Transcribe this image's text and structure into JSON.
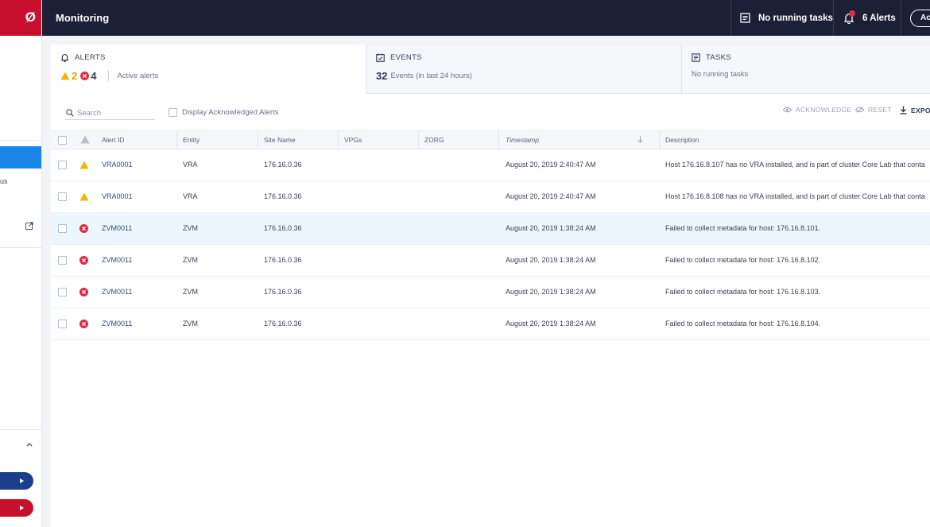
{
  "sidebar": {
    "logo_glyph": "Ø",
    "partial_item_label": "us"
  },
  "header": {
    "title": "Monitoring",
    "tasks_label": "No running tasks",
    "alerts_label": "6 Alerts",
    "action_label": "Ac"
  },
  "tabs": {
    "alerts": {
      "label": "ALERTS",
      "warning_count": "2",
      "error_count": "4",
      "subtitle": "Active alerts"
    },
    "events": {
      "label": "EVENTS",
      "count": "32",
      "subtitle": "Events (in last 24 hours)"
    },
    "tasks": {
      "label": "TASKS",
      "subtitle": "No running tasks"
    }
  },
  "toolbar": {
    "search_placeholder": "Search",
    "display_ack_label": "Display Acknowledged Alerts",
    "acknowledge_label": "ACKNOWLEDGE",
    "reset_label": "RESET",
    "export_label": "EXPO"
  },
  "table": {
    "columns": {
      "alert_id": "Alert ID",
      "entity": "Entity",
      "site_name": "Site Name",
      "vpgs": "VPGs",
      "zorg": "ZORG",
      "timestamp": "Timestamp",
      "description": "Description"
    },
    "rows": [
      {
        "severity": "warning",
        "alert_id": "VRA0001",
        "entity": "VRA",
        "site_name": "176.16.0.36",
        "vpgs": "",
        "zorg": "",
        "timestamp": "August 20, 2019 2:40:47 AM",
        "description": "Host 176.16.8.107 has no VRA installed, and is part of cluster Core Lab that conta"
      },
      {
        "severity": "warning",
        "alert_id": "VRA0001",
        "entity": "VRA",
        "site_name": "176.16.0.36",
        "vpgs": "",
        "zorg": "",
        "timestamp": "August 20, 2019 2:40:47 AM",
        "description": "Host 176.16.8.108 has no VRA installed, and is part of cluster Core Lab that conta"
      },
      {
        "severity": "error",
        "alert_id": "ZVM0011",
        "entity": "ZVM",
        "site_name": "176.16.0.36",
        "vpgs": "",
        "zorg": "",
        "timestamp": "August 20, 2019 1:38:24 AM",
        "description": "Failed to collect metadata for host: 176.16.8.101."
      },
      {
        "severity": "error",
        "alert_id": "ZVM0011",
        "entity": "ZVM",
        "site_name": "176.16.0.36",
        "vpgs": "",
        "zorg": "",
        "timestamp": "August 20, 2019 1:38:24 AM",
        "description": "Failed to collect metadata for host: 176.16.8.102."
      },
      {
        "severity": "error",
        "alert_id": "ZVM0011",
        "entity": "ZVM",
        "site_name": "176.16.0.36",
        "vpgs": "",
        "zorg": "",
        "timestamp": "August 20, 2019 1:38:24 AM",
        "description": "Failed to collect metadata for host: 176.16.8.103."
      },
      {
        "severity": "error",
        "alert_id": "ZVM0011",
        "entity": "ZVM",
        "site_name": "176.16.0.36",
        "vpgs": "",
        "zorg": "",
        "timestamp": "August 20, 2019 1:38:24 AM",
        "description": "Failed to collect metadata for host: 176.16.8.104."
      }
    ]
  },
  "colors": {
    "brand_red": "#c8102e",
    "header_bg": "#1c2036",
    "active_blue": "#1a87e8",
    "warning": "#f2b705",
    "error": "#e5293f"
  }
}
